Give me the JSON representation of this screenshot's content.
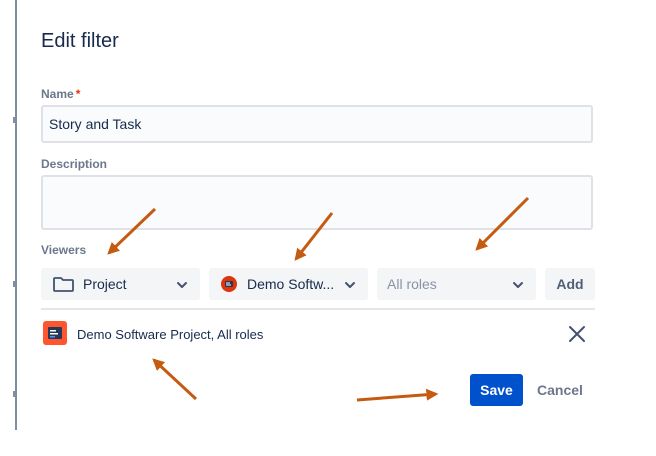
{
  "dialog": {
    "title": "Edit filter",
    "name_label": "Name",
    "required_mark": "*",
    "name_value": "Story and Task",
    "description_label": "Description",
    "description_value": "",
    "viewers_label": "Viewers"
  },
  "viewers_controls": {
    "type_select": {
      "value": "Project",
      "icon": "folder-icon"
    },
    "project_select": {
      "value": "Demo Softw...",
      "icon": "project-avatar-icon"
    },
    "role_select": {
      "placeholder": "All roles"
    },
    "add_label": "Add"
  },
  "viewers_list": [
    {
      "label": "Demo Software Project, All roles",
      "icon": "project-avatar-icon",
      "remove_icon": "close-icon"
    }
  ],
  "actions": {
    "save_label": "Save",
    "cancel_label": "Cancel"
  },
  "colors": {
    "primary": "#0052cc",
    "annotation_arrow": "#c55a11",
    "project_icon": "#de350b"
  }
}
